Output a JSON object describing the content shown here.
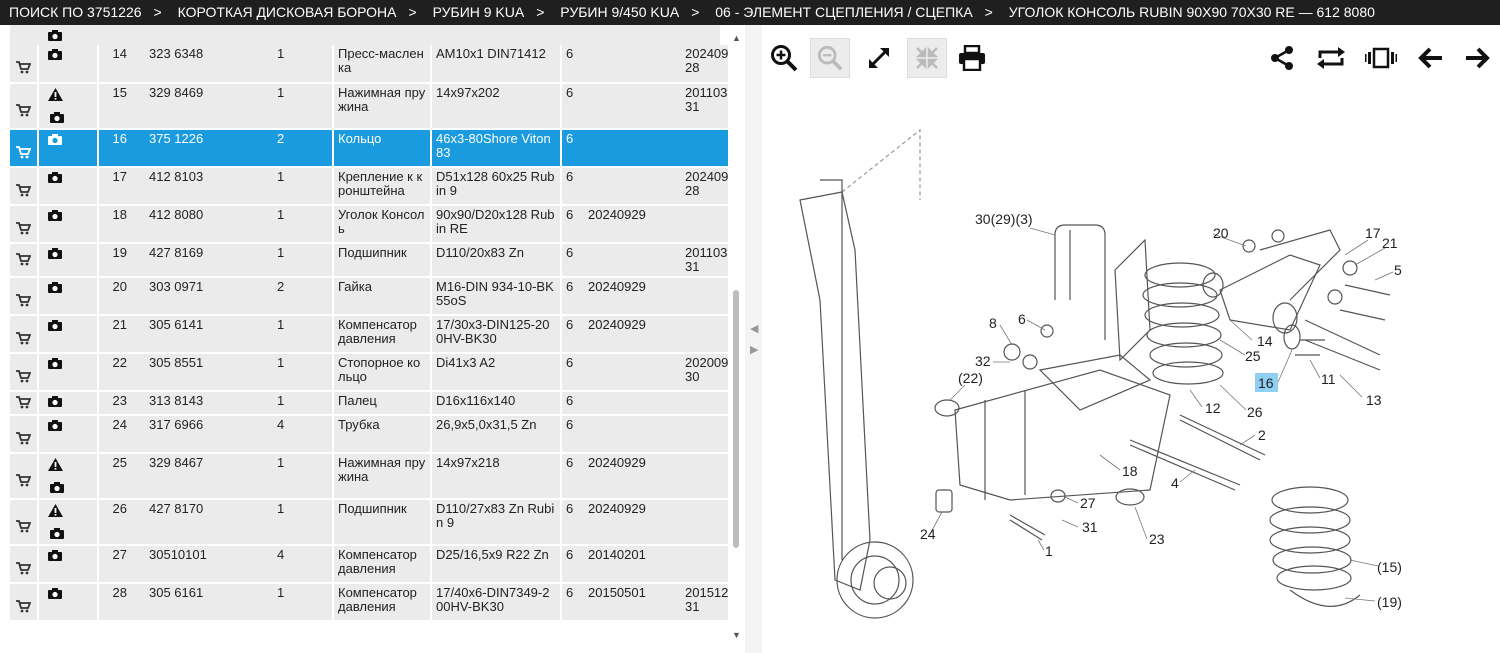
{
  "breadcrumb": [
    "ПОИСК ПО 3751226",
    "КОРОТКАЯ ДИСКОВАЯ БОРОНА",
    "РУБИН 9 KUA",
    "РУБИН 9/450 KUA",
    "06 - ЭЛЕМЕНТ СЦЕПЛЕНИЯ / СЦЕПКА",
    "УГОЛОК КОНСОЛЬ RUBIN 90X90 70X30 RE — 612 8080"
  ],
  "breadcrumb_separator": ">",
  "colors": {
    "selected_row": "#1a9be0",
    "row_bg": "#ebebeb",
    "header_bg": "#1f1f1f",
    "highlight": "#8ecff2"
  },
  "rows": [
    {
      "pos": "14",
      "number": "323 6348",
      "qty": "1",
      "name": "Пресс-масленка",
      "desc": "AM10x1 DIN71412",
      "group": "6",
      "date1": "",
      "date2": "20240928",
      "icons": [
        "camera-icon"
      ]
    },
    {
      "pos": "15",
      "number": "329 8469",
      "qty": "1",
      "name": "Нажимная пружина",
      "desc": "14x97x202",
      "group": "6",
      "date1": "",
      "date2": "20110331",
      "icons": [
        "warning-icon",
        "camera-icon"
      ]
    },
    {
      "pos": "16",
      "number": "375 1226",
      "qty": "2",
      "name": "Кольцо",
      "desc": "46x3-80Shore Viton83",
      "group": "6",
      "date1": "",
      "date2": "",
      "icons": [
        "camera-icon"
      ],
      "selected": true
    },
    {
      "pos": "17",
      "number": "412 8103",
      "qty": "1",
      "name": "Крепление к кронштейна",
      "desc": "D51x128 60x25 Rubin 9",
      "group": "6",
      "date1": "",
      "date2": "20240928",
      "icons": [
        "camera-icon"
      ]
    },
    {
      "pos": "18",
      "number": "412 8080",
      "qty": "1",
      "name": "Уголок Консоль",
      "desc": "90x90/D20x128 Rubin RE",
      "group": "6",
      "date1": "20240929",
      "date2": "",
      "icons": [
        "camera-icon"
      ]
    },
    {
      "pos": "19",
      "number": "427 8169",
      "qty": "1",
      "name": "Подшипник",
      "desc": "D110/20x83 Zn",
      "group": "6",
      "date1": "",
      "date2": "20110331",
      "icons": [
        "camera-icon"
      ]
    },
    {
      "pos": "20",
      "number": "303 0971",
      "qty": "2",
      "name": "Гайка",
      "desc": "M16-DIN 934-10-BK55oS",
      "group": "6",
      "date1": "20240929",
      "date2": "",
      "icons": [
        "camera-icon"
      ]
    },
    {
      "pos": "21",
      "number": "305 6141",
      "qty": "1",
      "name": "Компенсатор давления",
      "desc": "17/30x3-DIN125-200HV-BK30",
      "group": "6",
      "date1": "20240929",
      "date2": "",
      "icons": [
        "camera-icon"
      ]
    },
    {
      "pos": "22",
      "number": "305 8551",
      "qty": "1",
      "name": "Стопорное кольцо",
      "desc": "Di41x3 A2",
      "group": "6",
      "date1": "",
      "date2": "20200930",
      "icons": [
        "camera-icon"
      ]
    },
    {
      "pos": "23",
      "number": "313 8143",
      "qty": "1",
      "name": "Палец",
      "desc": "D16x116x140",
      "group": "6",
      "date1": "",
      "date2": "",
      "icons": [
        "camera-icon"
      ]
    },
    {
      "pos": "24",
      "number": "317 6966",
      "qty": "4",
      "name": "Трубка",
      "desc": "26,9x5,0x31,5 Zn",
      "group": "6",
      "date1": "",
      "date2": "",
      "icons": [
        "camera-icon"
      ]
    },
    {
      "pos": "25",
      "number": "329 8467",
      "qty": "1",
      "name": "Нажимная пружина",
      "desc": "14x97x218",
      "group": "6",
      "date1": "20240929",
      "date2": "",
      "icons": [
        "warning-icon",
        "camera-icon"
      ]
    },
    {
      "pos": "26",
      "number": "427 8170",
      "qty": "1",
      "name": "Подшипник",
      "desc": "D110/27x83 Zn Rubin 9",
      "group": "6",
      "date1": "20240929",
      "date2": "",
      "icons": [
        "warning-icon",
        "camera-icon"
      ]
    },
    {
      "pos": "27",
      "number": "30510101",
      "qty": "4",
      "name": "Компенсатор давления",
      "desc": "D25/16,5x9 R22 Zn",
      "group": "6",
      "date1": "20140201",
      "date2": "",
      "icons": [
        "camera-icon"
      ]
    },
    {
      "pos": "28",
      "number": "305 6161",
      "qty": "1",
      "name": "Компенсатор давления",
      "desc": "17/40x6-DIN7349-200HV-BK30",
      "group": "6",
      "date1": "20150501",
      "date2": "20151231",
      "icons": [
        "camera-icon"
      ]
    }
  ],
  "toolbar": {
    "left": [
      "zoom-in-icon",
      "zoom-out-icon",
      "fullscreen-icon",
      "fit-icon",
      "print-icon"
    ],
    "right": [
      "share-icon",
      "swap-icon",
      "carousel-icon",
      "arrow-left-icon",
      "arrow-right-icon"
    ]
  },
  "diagram_labels": [
    "30(29)(3)",
    "20",
    "6",
    "17",
    "21",
    "5",
    "8",
    "32",
    "(22)",
    "14",
    "25",
    "16",
    "11",
    "13",
    "12",
    "26",
    "2",
    "18",
    "4",
    "27",
    "31",
    "23",
    "24",
    "1",
    "(15)",
    "(19)"
  ],
  "selected_callout": "16"
}
